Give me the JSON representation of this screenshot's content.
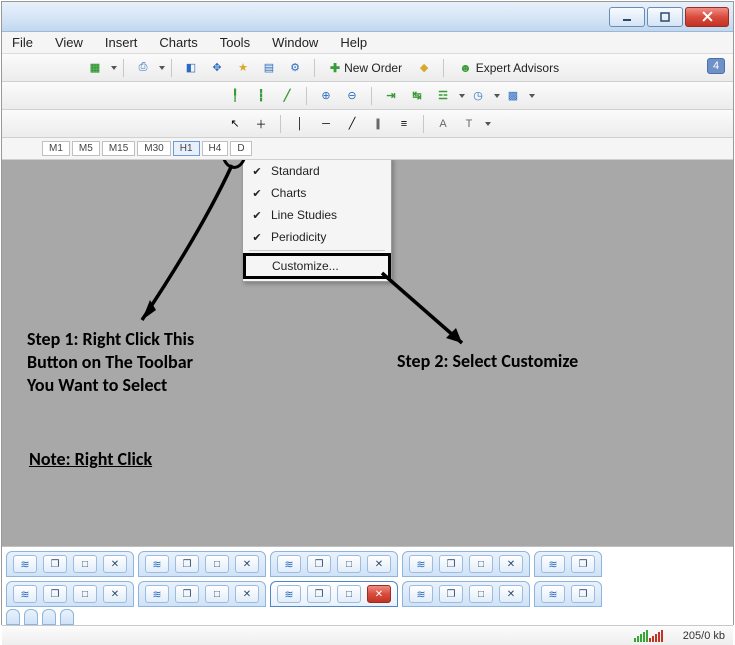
{
  "menubar": [
    "File",
    "View",
    "Insert",
    "Charts",
    "Tools",
    "Window",
    "Help"
  ],
  "toolbar1": {
    "new_order": "New Order",
    "expert_advisors": "Expert Advisors",
    "badge": "4"
  },
  "period_tabs": [
    "M1",
    "M5",
    "M15",
    "M30",
    "H1",
    "H4",
    "D"
  ],
  "active_period": "H1",
  "context_menu": {
    "items": [
      {
        "label": "Standard",
        "checked": true
      },
      {
        "label": "Charts",
        "checked": true
      },
      {
        "label": "Line Studies",
        "checked": true
      },
      {
        "label": "Periodicity",
        "checked": true
      }
    ],
    "customize": "Customize..."
  },
  "annotations": {
    "step1_l1": "Step 1: Right Click This",
    "step1_l2": "Button on The Toolbar",
    "step1_l3": "You Want to Select",
    "step2": "Step 2: Select Customize",
    "note": "Note: Right Click"
  },
  "statusbar": {
    "traffic": "205/0 kb"
  }
}
